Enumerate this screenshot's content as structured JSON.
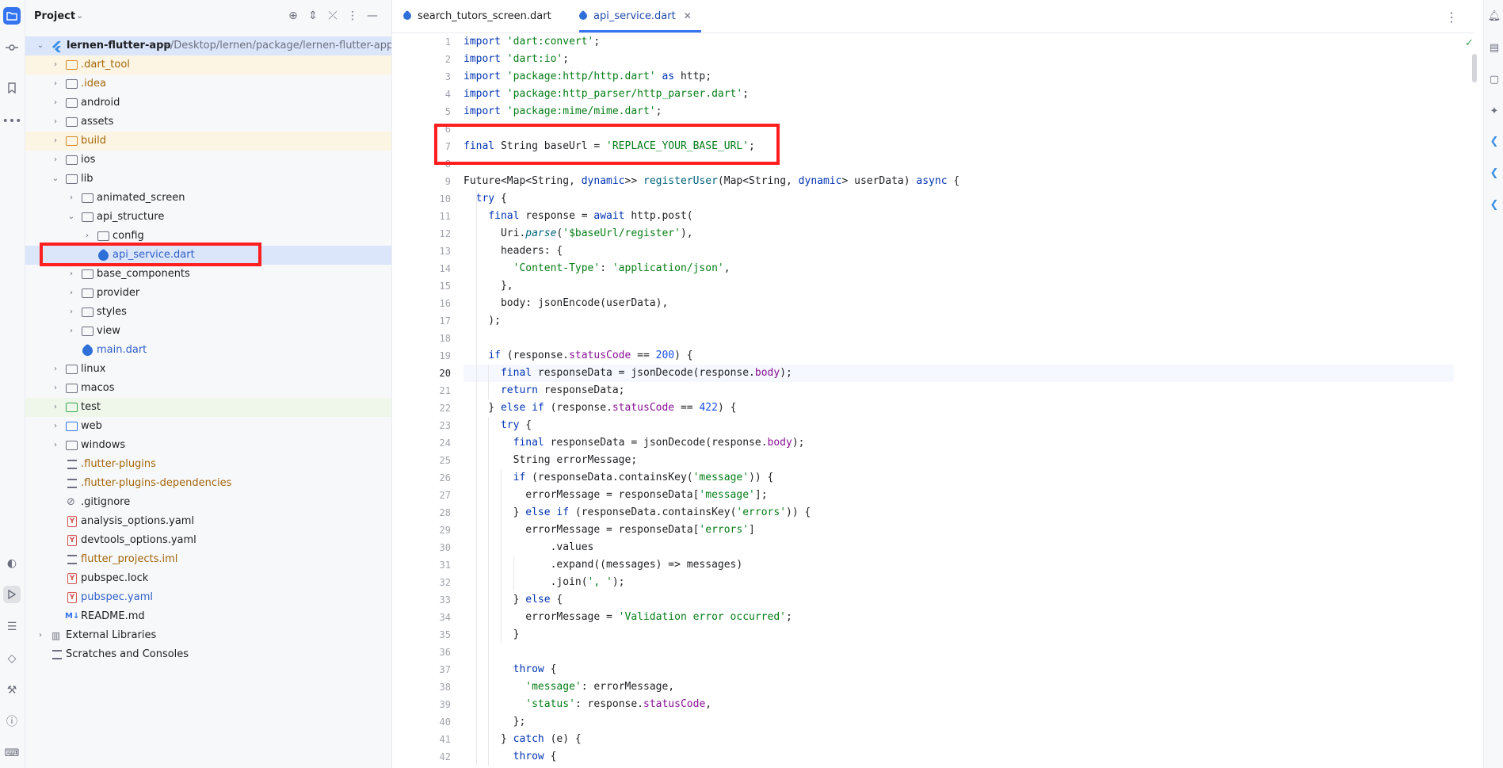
{
  "project": {
    "title": "Project",
    "root_name": "lernen-flutter-app",
    "root_path": "~/Desktop/lernen/package/lernen-flutter-app",
    "tree": [
      {
        "label": ".dart_tool"
      },
      {
        "label": ".idea"
      },
      {
        "label": "android"
      },
      {
        "label": "assets"
      },
      {
        "label": "build"
      },
      {
        "label": "ios"
      },
      {
        "label": "lib"
      },
      {
        "label": "animated_screen"
      },
      {
        "label": "api_structure"
      },
      {
        "label": "config"
      },
      {
        "label": "api_service.dart"
      },
      {
        "label": "base_components"
      },
      {
        "label": "provider"
      },
      {
        "label": "styles"
      },
      {
        "label": "view"
      },
      {
        "label": "main.dart"
      },
      {
        "label": "linux"
      },
      {
        "label": "macos"
      },
      {
        "label": "test"
      },
      {
        "label": "web"
      },
      {
        "label": "windows"
      },
      {
        "label": ".flutter-plugins"
      },
      {
        "label": ".flutter-plugins-dependencies"
      },
      {
        "label": ".gitignore"
      },
      {
        "label": "analysis_options.yaml"
      },
      {
        "label": "devtools_options.yaml"
      },
      {
        "label": "flutter_projects.iml"
      },
      {
        "label": "pubspec.lock"
      },
      {
        "label": "pubspec.yaml"
      },
      {
        "label": "README.md"
      },
      {
        "label": "External Libraries"
      },
      {
        "label": "Scratches and Consoles"
      }
    ]
  },
  "tabs": [
    {
      "label": "search_tutors_screen.dart"
    },
    {
      "label": "api_service.dart"
    }
  ],
  "line_numbers": [
    "1",
    "2",
    "3",
    "4",
    "5",
    "6",
    "7",
    "8",
    "9",
    "10",
    "11",
    "12",
    "13",
    "14",
    "15",
    "16",
    "17",
    "18",
    "19",
    "20",
    "21",
    "22",
    "23",
    "24",
    "25",
    "26",
    "27",
    "28",
    "29",
    "30",
    "31",
    "32",
    "33",
    "34",
    "35",
    "36",
    "37",
    "38",
    "39",
    "40",
    "41",
    "42"
  ],
  "code": [
    "import 'dart:convert';",
    "import 'dart:io';",
    "import 'package:http/http.dart' as http;",
    "import 'package:http_parser/http_parser.dart';",
    "import 'package:mime/mime.dart';",
    "",
    "final String baseUrl = 'REPLACE_YOUR_BASE_URL';",
    "",
    "Future<Map<String, dynamic>> registerUser(Map<String, dynamic> userData) async {",
    "  try {",
    "    final response = await http.post(",
    "      Uri.parse('$baseUrl/register'),",
    "      headers: {",
    "        'Content-Type': 'application/json',",
    "      },",
    "      body: jsonEncode(userData),",
    "    );",
    "",
    "    if (response.statusCode == 200) {",
    "      final responseData = jsonDecode(response.body);",
    "      return responseData;",
    "    } else if (response.statusCode == 422) {",
    "      try {",
    "        final responseData = jsonDecode(response.body);",
    "        String errorMessage;",
    "        if (responseData.containsKey('message')) {",
    "          errorMessage = responseData['message'];",
    "        } else if (responseData.containsKey('errors')) {",
    "          errorMessage = responseData['errors']",
    "              .values",
    "              .expand((messages) => messages)",
    "              .join(', ');",
    "        } else {",
    "          errorMessage = 'Validation error occurred';",
    "        }",
    "",
    "        throw {",
    "          'message': errorMessage,",
    "          'status': response.statusCode,",
    "        };",
    "      } catch (e) {",
    "        throw {"
  ]
}
